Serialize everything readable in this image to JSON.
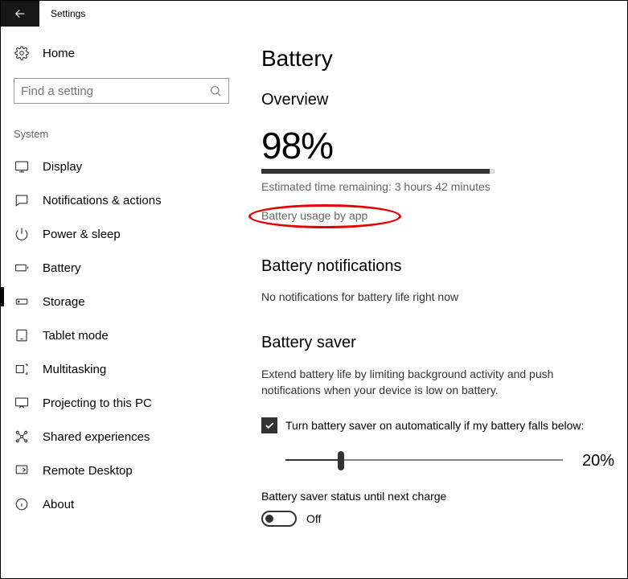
{
  "titlebar": {
    "title": "Settings"
  },
  "sidebar": {
    "home": "Home",
    "search_placeholder": "Find a setting",
    "section": "System",
    "items": [
      {
        "label": "Display"
      },
      {
        "label": "Notifications & actions"
      },
      {
        "label": "Power & sleep"
      },
      {
        "label": "Battery"
      },
      {
        "label": "Storage"
      },
      {
        "label": "Tablet mode"
      },
      {
        "label": "Multitasking"
      },
      {
        "label": "Projecting to this PC"
      },
      {
        "label": "Shared experiences"
      },
      {
        "label": "Remote Desktop"
      },
      {
        "label": "About"
      }
    ]
  },
  "main": {
    "title": "Battery",
    "overview": {
      "heading": "Overview",
      "percent": "98%",
      "progress_pct": 98,
      "estimate": "Estimated time remaining: 3 hours 42 minutes",
      "usage_link": "Battery usage by app"
    },
    "notifications": {
      "heading": "Battery notifications",
      "text": "No notifications for battery life right now"
    },
    "saver": {
      "heading": "Battery saver",
      "desc": "Extend battery life by limiting background activity and push notifications when your device is low on battery.",
      "checkbox_label": "Turn battery saver on automatically if my battery falls below:",
      "threshold": "20%",
      "status_label": "Battery saver status until next charge",
      "toggle_state": "Off"
    }
  }
}
